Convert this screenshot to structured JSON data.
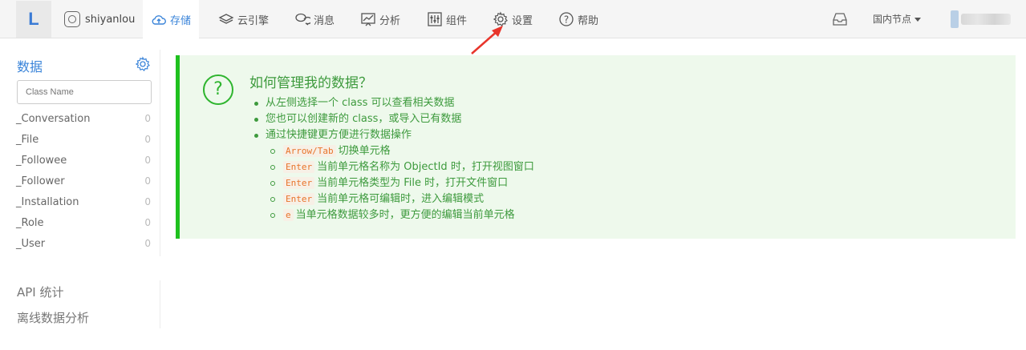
{
  "topbar": {
    "logo": "L",
    "app_name": "shiyanlou",
    "nav": [
      {
        "label": "存储",
        "icon": "cloud-upload-icon",
        "active": true
      },
      {
        "label": "云引擎",
        "icon": "layers-icon"
      },
      {
        "label": "消息",
        "icon": "chat-icon"
      },
      {
        "label": "分析",
        "icon": "analytics-icon"
      },
      {
        "label": "组件",
        "icon": "sliders-icon"
      },
      {
        "label": "设置",
        "icon": "gear-icon"
      },
      {
        "label": "帮助",
        "icon": "help-icon"
      }
    ],
    "region": "国内节点"
  },
  "sidebar": {
    "title": "数据",
    "search_placeholder": "Class Name",
    "classes": [
      {
        "name": "_Conversation",
        "count": "0"
      },
      {
        "name": "_File",
        "count": "0"
      },
      {
        "name": "_Followee",
        "count": "0"
      },
      {
        "name": "_Follower",
        "count": "0"
      },
      {
        "name": "_Installation",
        "count": "0"
      },
      {
        "name": "_Role",
        "count": "0"
      },
      {
        "name": "_User",
        "count": "0"
      }
    ],
    "links": [
      "API 统计",
      "离线数据分析"
    ]
  },
  "panel": {
    "title": "如何管理我的数据？",
    "bullets": [
      "从左侧选择一个 class 可以查看相关数据",
      "您也可以创建新的 class，或导入已有数据",
      "通过快捷键更方便进行数据操作"
    ],
    "shortcuts": [
      {
        "key": "Arrow/Tab",
        "text": "切换单元格"
      },
      {
        "key": "Enter",
        "text": "当前单元格名称为 ObjectId 时，打开视图窗口"
      },
      {
        "key": "Enter",
        "text": "当前单元格类型为 File 时，打开文件窗口"
      },
      {
        "key": "Enter",
        "text": "当前单元格可编辑时，进入编辑模式"
      },
      {
        "key": "e",
        "text": "当单元格数据较多时，更方便的编辑当前单元格"
      }
    ]
  },
  "colors": {
    "accent": "#3a84d9",
    "success": "#3d9a3d",
    "panel_bg": "#eef9ec",
    "annotation_arrow": "#e8352b"
  }
}
